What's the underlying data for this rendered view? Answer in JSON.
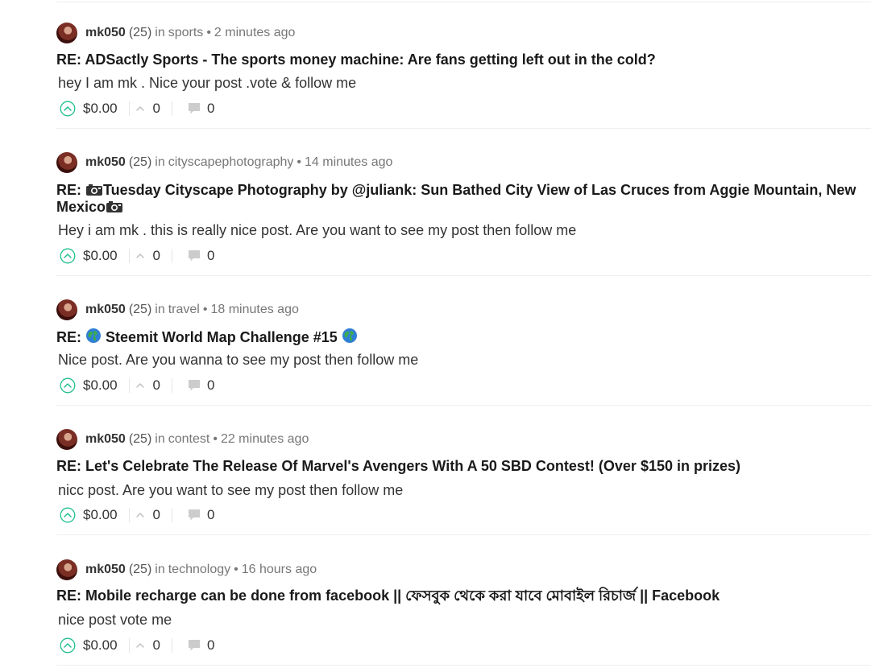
{
  "posts": [
    {
      "author": "mk050",
      "reputation": "(25)",
      "in_word": "in",
      "category": "sports",
      "bullet": "•",
      "time": "2 minutes ago",
      "title_prefix": "RE: ADSactly Sports - The sports money machine: Are fans getting left out in the cold?",
      "body": "hey I am mk . Nice your post .vote & follow me",
      "payout": "$0.00",
      "votes": "0",
      "replies": "0"
    },
    {
      "author": "mk050",
      "reputation": "(25)",
      "in_word": "in",
      "category": "cityscapephotography",
      "bullet": "•",
      "time": "14 minutes ago",
      "title_prefix": "RE: ",
      "title_main": "Tuesday Cityscape Photography by @juliank: Sun Bathed City View of Las Cruces from Aggie Mountain, New Mexico",
      "body": "Hey i am mk . this is really nice post. Are you want to see my post then follow me",
      "payout": "$0.00",
      "votes": "0",
      "replies": "0"
    },
    {
      "author": "mk050",
      "reputation": "(25)",
      "in_word": "in",
      "category": "travel",
      "bullet": "•",
      "time": "18 minutes ago",
      "title_prefix": "RE: ",
      "title_main": " Steemit World Map Challenge #15 ",
      "body": "Nice post. Are you wanna to see my post then follow me",
      "payout": "$0.00",
      "votes": "0",
      "replies": "0"
    },
    {
      "author": "mk050",
      "reputation": "(25)",
      "in_word": "in",
      "category": "contest",
      "bullet": "•",
      "time": "22 minutes ago",
      "title_prefix": "RE: Let's Celebrate The Release Of Marvel's Avengers With A 50 SBD Contest! (Over $150 in prizes)",
      "body": "nicc post. Are you want to see my post then follow me",
      "payout": "$0.00",
      "votes": "0",
      "replies": "0"
    },
    {
      "author": "mk050",
      "reputation": "(25)",
      "in_word": "in",
      "category": "technology",
      "bullet": "•",
      "time": "16 hours ago",
      "title_prefix": "RE: Mobile recharge can be done from facebook || ফেসবুক থেকে করা যাবে মোবাইল রিচার্জ || Facebook",
      "body": "nice post vote me",
      "payout": "$0.00",
      "votes": "0",
      "replies": "0"
    }
  ],
  "icons": {
    "upvote": "upvote-circle-icon",
    "votes": "chevron-up-icon",
    "replies": "comment-bubble-icon",
    "camera": "camera-icon",
    "globe": "globe-icon"
  },
  "colors": {
    "accent": "#1fbf8f",
    "muted": "#777777",
    "divider": "#eeeeee"
  }
}
